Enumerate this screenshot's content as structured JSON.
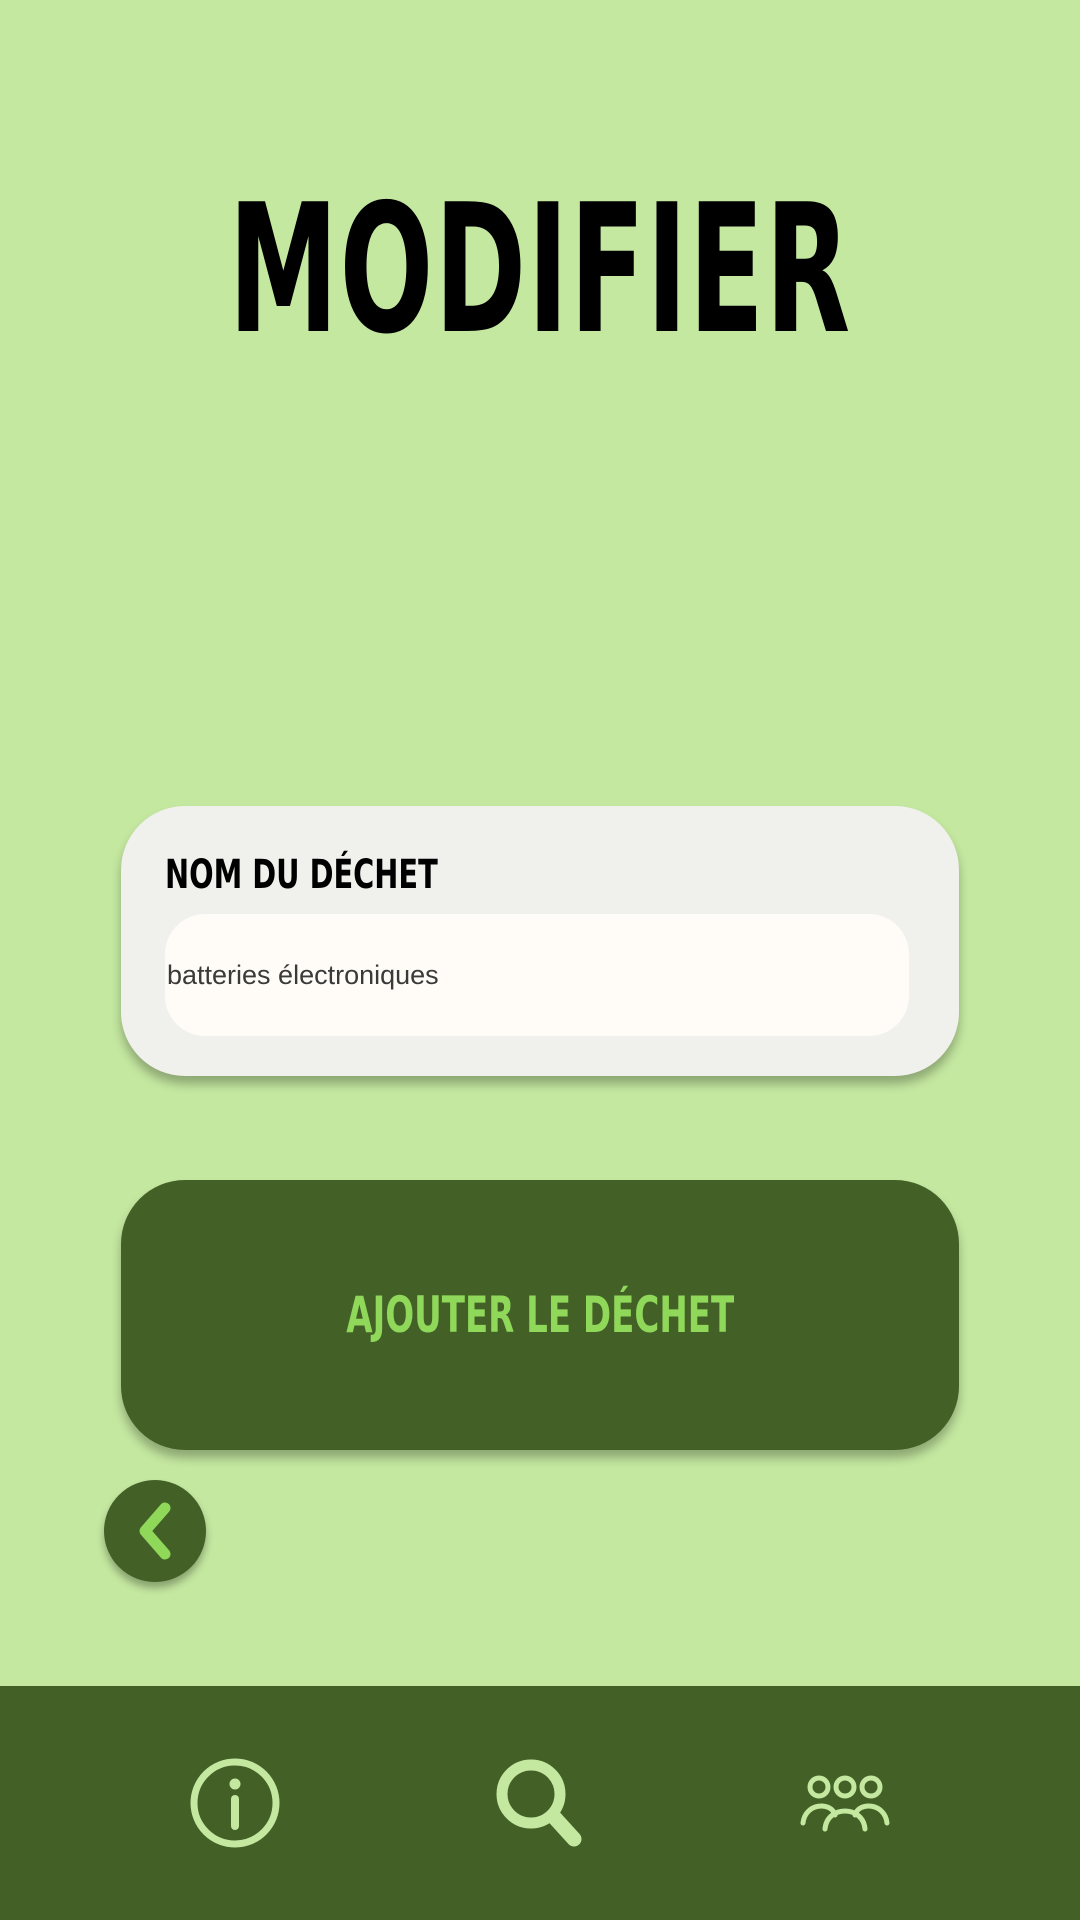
{
  "header": {
    "title": "MODIFIER"
  },
  "form": {
    "label": "NOM DU DÉCHET",
    "value": "batteries électroniques"
  },
  "actions": {
    "submit_label": "AJOUTER LE DÉCHET",
    "back_icon": "chevron-left-icon"
  },
  "nav": {
    "items": [
      {
        "icon": "info-icon"
      },
      {
        "icon": "search-icon"
      },
      {
        "icon": "users-icon"
      }
    ]
  },
  "colors": {
    "background": "#c4e8a0",
    "dark_green": "#436127",
    "accent_green": "#8fd85a",
    "card": "#f0f0ec"
  }
}
